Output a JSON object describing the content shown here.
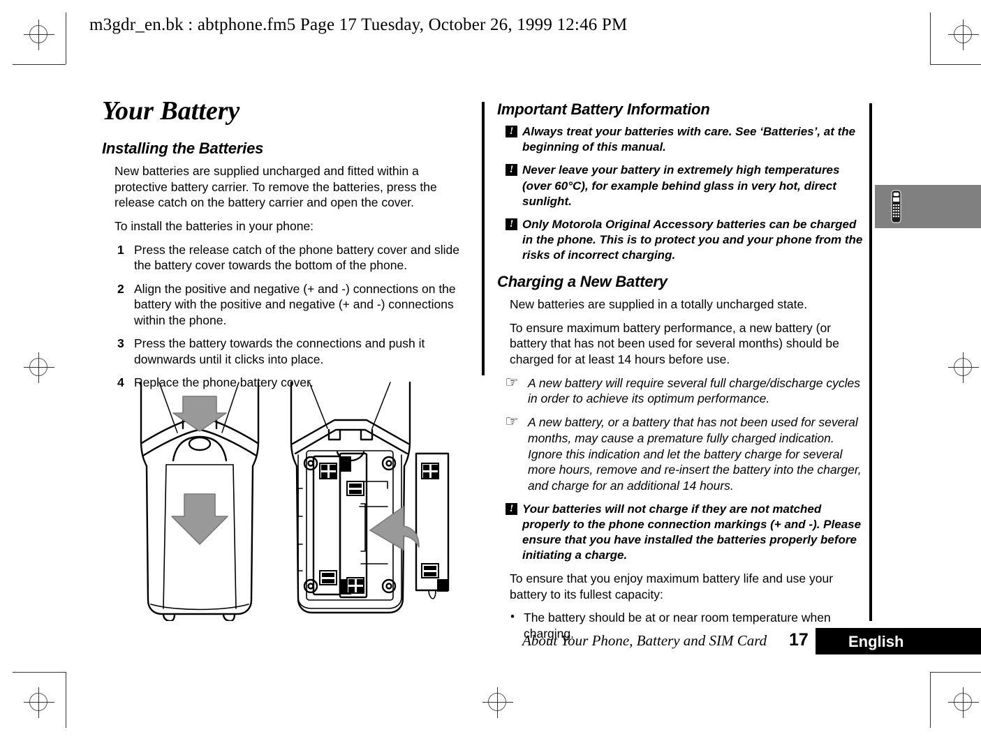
{
  "file_header": "m3gdr_en.bk : abtphone.fm5  Page 17  Tuesday, October 26, 1999  12:46 PM",
  "left_column": {
    "chapter_title": "Your Battery",
    "section_title": "Installing the Batteries",
    "intro_paragraph": "New batteries are supplied uncharged and fitted within a protective battery carrier. To remove the batteries, press the release catch on the battery carrier and open the cover.",
    "lead_in": "To install the batteries in your phone:",
    "steps": [
      {
        "num": "1",
        "text": "Press the release catch of the phone battery cover and slide the battery cover towards the bottom of the phone."
      },
      {
        "num": "2",
        "text": "Align the positive and negative (+ and -) connections on the battery with the positive and negative (+ and -) connections within the phone."
      },
      {
        "num": "3",
        "text": "Press the battery towards the connections and push it downwards until it clicks into place."
      },
      {
        "num": "4",
        "text": "Replace the phone battery cover."
      }
    ]
  },
  "right_column": {
    "section_title_1": "Important Battery Information",
    "warnings": [
      {
        "icon": "warning-icon",
        "glyph": "!",
        "text": "Always treat your batteries with care. See ‘Batteries’, at the beginning of this manual."
      },
      {
        "icon": "warning-icon",
        "glyph": "!",
        "text": "Never leave your battery in extremely high temperatures (over 60°C), for example behind glass in very hot, direct sunlight."
      },
      {
        "icon": "warning-icon",
        "glyph": "!",
        "text": "Only Motorola Original Accessory batteries can be charged in the phone. This is to protect you and your phone from the risks of incorrect charging."
      }
    ],
    "section_title_2": "Charging a New Battery",
    "paragraph_1": "New batteries are supplied in a totally uncharged state.",
    "paragraph_2": "To ensure maximum battery performance, a new battery (or battery that has not been used for several months) should be charged for at least 14 hours before use.",
    "notes": [
      {
        "icon": "pointing-hand-icon",
        "glyph": "☞",
        "text": "A new battery will require several full charge/discharge cycles in order to achieve its optimum performance."
      },
      {
        "icon": "pointing-hand-icon",
        "glyph": "☞",
        "text": "A new battery, or a battery that has not been used for several months, may cause a premature fully charged indication. Ignore this indication and let the battery charge for several more hours, remove and re-insert the battery into the charger, and charge for an additional 14 hours."
      }
    ],
    "warning_final": {
      "icon": "warning-icon",
      "glyph": "!",
      "text": "Your batteries will not charge if they are not matched properly to the phone connection markings (+ and -). Please ensure that you have installed the batteries properly before initiating a charge."
    },
    "paragraph_3": "To ensure that you enjoy maximum battery life and use your battery to its fullest capacity:",
    "bullets": [
      {
        "marker": "•",
        "text": "The battery should be at or near room temperature when charging."
      }
    ]
  },
  "footer": {
    "running_title": "About Your Phone, Battery and SIM Card",
    "page_number": "17",
    "language": "English"
  },
  "thumb_tab": {
    "icon": "mobile-phone-icon",
    "color": "#808080"
  },
  "figure": {
    "name": "battery-installation-diagram",
    "arrow_color": "#999999",
    "captions": []
  }
}
